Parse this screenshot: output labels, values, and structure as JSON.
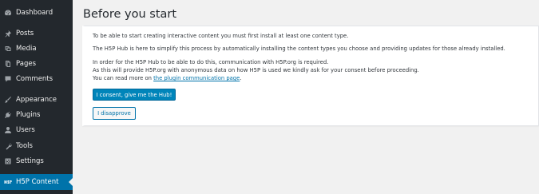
{
  "sidebar": {
    "items": [
      {
        "label": "Dashboard",
        "icon": "dashboard-icon"
      },
      {
        "label": "Posts",
        "icon": "pin-icon"
      },
      {
        "label": "Media",
        "icon": "media-icon"
      },
      {
        "label": "Pages",
        "icon": "pages-icon"
      },
      {
        "label": "Comments",
        "icon": "comments-icon"
      },
      {
        "label": "Appearance",
        "icon": "brush-icon"
      },
      {
        "label": "Plugins",
        "icon": "plug-icon"
      },
      {
        "label": "Users",
        "icon": "user-icon"
      },
      {
        "label": "Tools",
        "icon": "wrench-icon"
      },
      {
        "label": "Settings",
        "icon": "settings-icon"
      },
      {
        "label": "H5P Content",
        "icon": "h5p-icon",
        "active": true
      }
    ]
  },
  "main": {
    "title": "Before you start",
    "notice": {
      "line1": "To be able to start creating interactive content you must first install at least one content type.",
      "line2": "The H5P Hub is here to simplify this process by automatically installing the content types you choose and providing updates for those already installed.",
      "line3": "In order for the H5P Hub to be able to do this, communication with H5P.org is required.",
      "line4": "As this will provide H5P.org with anonymous data on how H5P is used we kindly ask for your consent before proceeding.",
      "line5_prefix": "You can read more on ",
      "line5_link": "the plugin communication page",
      "line5_suffix": ".",
      "consent_label": "I consent, give me the Hub!",
      "disapprove_label": "I disapprove"
    }
  },
  "colors": {
    "sidebar_bg": "#23282d",
    "active_bg": "#0073aa",
    "primary_button": "#0085ba"
  }
}
